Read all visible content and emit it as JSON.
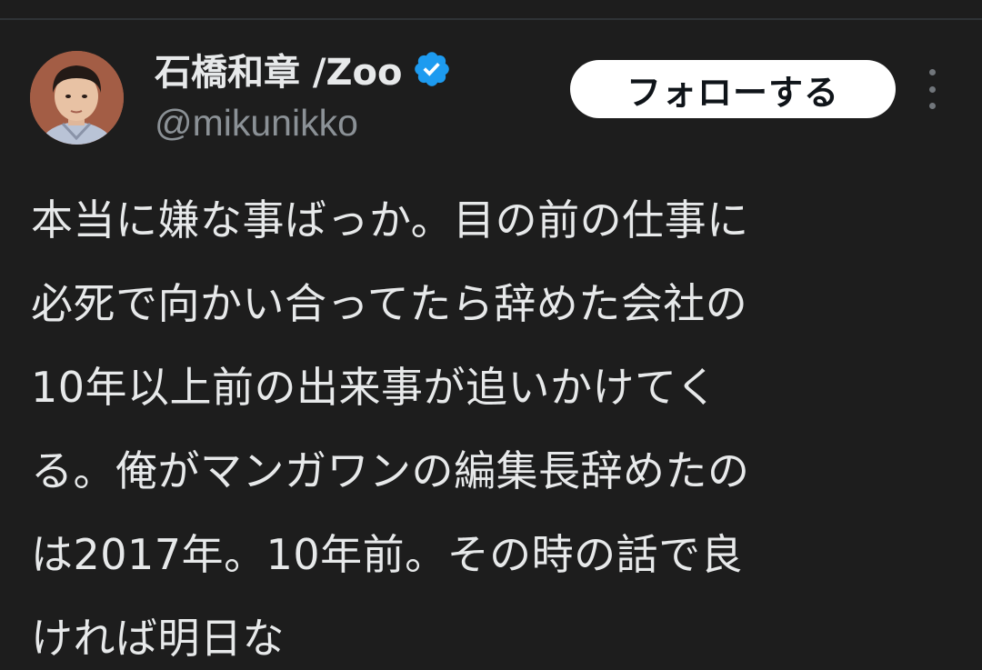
{
  "user": {
    "display_name": "石橋和章 /Zoo",
    "handle": "@mikunikko",
    "verified_icon": "verified-badge-icon",
    "avatar_icon": "profile-avatar"
  },
  "actions": {
    "follow_label": "フォローする",
    "more_icon": "more-options-icon"
  },
  "tweet": {
    "lines": [
      "本当に嫌な事ばっか。目の前の仕事に",
      "必死で向かい合ってたら辞めた会社の",
      "10年以上前の出来事が追いかけてく",
      "る。俺がマンガワンの編集長辞めたの",
      "は2017年。10年前。その時の話で良",
      "ければ明日な"
    ]
  },
  "colors": {
    "background": "#1d1d1d",
    "text": "#e7e9ea",
    "muted": "#8b9196",
    "verified": "#1d9bf0",
    "follow_bg": "#ffffff"
  }
}
